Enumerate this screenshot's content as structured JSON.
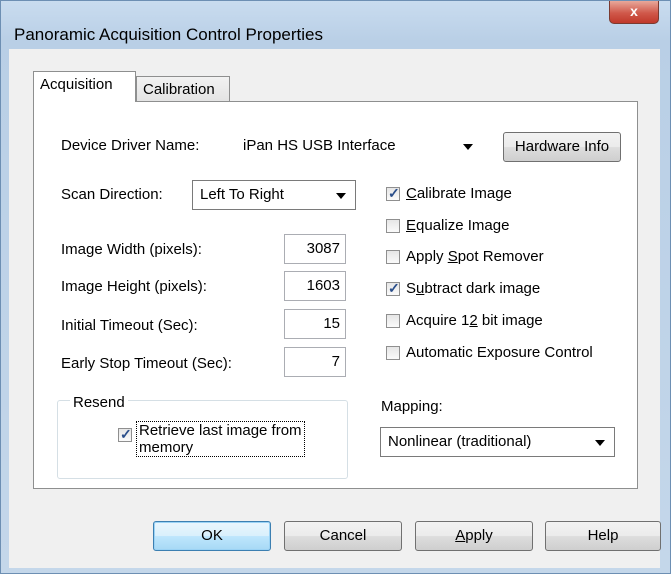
{
  "window": {
    "title": "Panoramic Acquisition Control Properties",
    "close_glyph": "x"
  },
  "tabs": [
    {
      "label": "Acquisition"
    },
    {
      "label": "Calibration"
    }
  ],
  "device": {
    "label": "Device Driver Name:",
    "value": "iPan HS USB Interface",
    "hardware_button": "Hardware Info"
  },
  "scan": {
    "label": "Scan Direction:",
    "value": "Left To Right"
  },
  "fields": [
    {
      "label": "Image Width (pixels):",
      "value": "3087"
    },
    {
      "label": "Image Height (pixels):",
      "value": "1603"
    },
    {
      "label": "Initial Timeout (Sec):",
      "value": "15"
    },
    {
      "label": "Early Stop Timeout (Sec):",
      "value": "7"
    }
  ],
  "checks": [
    {
      "pre": "",
      "key": "C",
      "post": "alibrate Image",
      "checked": true
    },
    {
      "pre": "",
      "key": "E",
      "post": "qualize Image",
      "checked": false
    },
    {
      "pre": "Apply ",
      "key": "S",
      "post": "pot Remover",
      "checked": false
    },
    {
      "pre": "S",
      "key": "u",
      "post": "btract dark image",
      "checked": true
    },
    {
      "pre": "Acquire 1",
      "key": "2",
      "post": " bit image",
      "checked": false
    },
    {
      "pre": "Automatic Exposure Control",
      "key": "",
      "post": "",
      "checked": false
    }
  ],
  "resend": {
    "title": "Resend",
    "label_line1": "Retrieve last image from",
    "label_line2": "memory",
    "checked": true
  },
  "mapping": {
    "label": "Mapping:",
    "value": "Nonlinear (traditional)"
  },
  "buttons": {
    "ok": "OK",
    "cancel": "Cancel",
    "apply_key": "A",
    "apply_rest": "pply",
    "help": "Help"
  }
}
